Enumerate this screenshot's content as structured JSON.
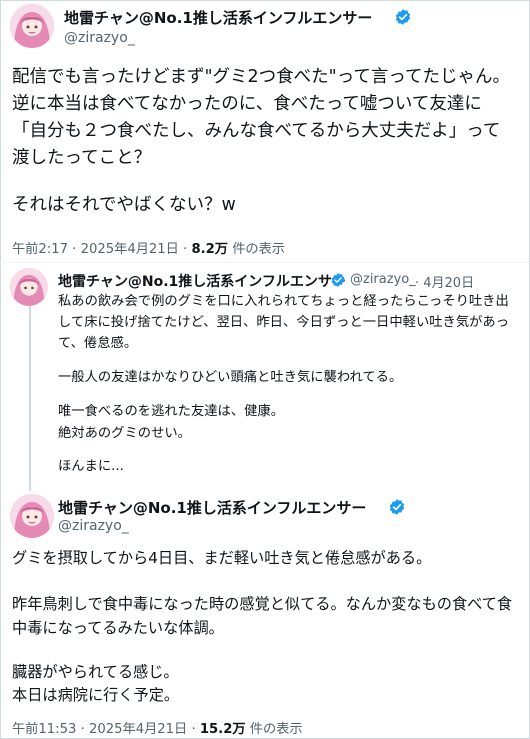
{
  "main_post": {
    "display_name": "地雷チャン@No.1推し活系インフルエンサー",
    "handle": "@zirazyo_",
    "lines": [
      "配信でも言ったけどまず\"グミ2つ食べた\"って言ってたじゃん。",
      "逆に本当は食べてなかったのに、食べたって嘘ついて友達に",
      "「自分も２つ食べたし、みんな食べてるから大丈夫だよ」って",
      "渡したってこと？",
      "",
      "それはそれでやばくない？w"
    ],
    "time": "午前2:17 · 2025年4月21日 · ",
    "views": "8.2万",
    "views_suffix": " 件の表示"
  },
  "quoted_post": {
    "display_name": "地雷チャン@No.1推し活系インフルエンサー",
    "handle": "@zirazyo_",
    "date": "· 4月20日",
    "lines": [
      "私あの飲み会で例のグミを口に入れられてちょっと経ったらこっそり吐き出",
      "して床に投げ捨てたけど、翌日、昨日、今日ずっと一日中軽い吐き気があっ",
      "て、倦怠感。",
      "",
      "一般人の友達はかなりひどい頭痛と吐き気に襲われてる。",
      "",
      "唯一食べるのを逃れた友達は、健康。",
      "絶対あのグミのせい。",
      "",
      "ほんまに..."
    ]
  },
  "thread_post": {
    "display_name": "地雷チャン@No.1推し活系インフルエンサー",
    "handle": "@zirazyo_",
    "lines": [
      "グミを摂取してから4日目、まだ軽い吐き気と倦怠感がある。",
      "",
      "昨年鳥刺しで食中毒になった時の感覚と似てる。なんか変なもの食べて食",
      "中毒になってるみたいな体調。",
      "",
      "臓器がやられてる感じ。",
      "本日は病院に行く予定。"
    ],
    "time": "午前11:53 · 2025年4月21日 · ",
    "views": "15.2万",
    "views_suffix": " 件の表示"
  },
  "icons": {
    "verified": "verified-badge-icon",
    "avatar": "avatar-pink-hair"
  },
  "colors": {
    "text": "#0f1419",
    "secondary": "#536471",
    "verified": "#1d9bf0",
    "border": "#cfd9de"
  }
}
